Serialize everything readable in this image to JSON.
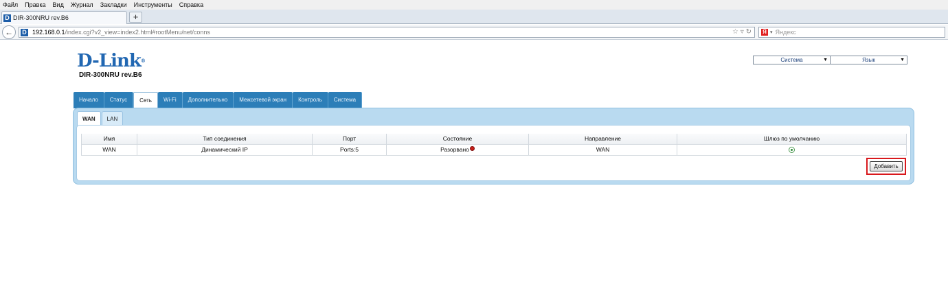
{
  "browser": {
    "menu": [
      "Файл",
      "Правка",
      "Вид",
      "Журнал",
      "Закладки",
      "Инструменты",
      "Справка"
    ],
    "tab_title": "DIR-300NRU rev.B6",
    "new_tab": "+",
    "url_host": "192.168.0.1",
    "url_path": "/index.cgi?v2_view=index2.html#rootMenu/net/conns",
    "search_placeholder": "Яндекс",
    "search_engine_icon": "Я"
  },
  "router": {
    "logo": "D-Link",
    "model": "DIR-300NRU rev.B6",
    "system_select": "Система",
    "language_select": "Язык",
    "main_tabs": [
      "Начало",
      "Статус",
      "Сеть",
      "Wi-Fi",
      "Дополнительно",
      "Межсетевой экран",
      "Контроль",
      "Система"
    ],
    "active_main_tab": "Сеть",
    "sub_tabs": [
      "WAN",
      "LAN"
    ],
    "active_sub_tab": "WAN",
    "table": {
      "headers": [
        "Имя",
        "Тип соединения",
        "Порт",
        "Состояние",
        "Направление",
        "Шлюз по умолчанию"
      ],
      "rows": [
        {
          "name": "WAN",
          "type": "Динамический IP",
          "port": "Ports:5",
          "state": "Разорвано",
          "direction": "WAN",
          "default_gateway": true
        }
      ]
    },
    "add_button": "Добавить"
  },
  "colors": {
    "accent": "#2c7eb8",
    "panel": "#b9daf0",
    "logo": "#2167b2",
    "highlight": "#d8181c"
  }
}
